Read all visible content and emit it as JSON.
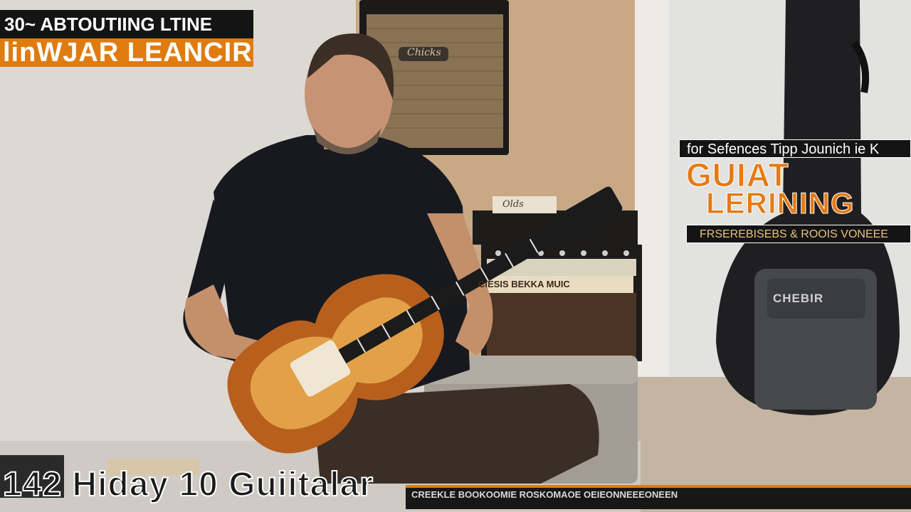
{
  "overlays": {
    "top_left_line1": "30~ ABTOUTIING LTINE",
    "top_left_line2": "linWJAR LEANCIR",
    "right_tagline": "for Sefences Tipp Jounich ie K",
    "right_title_line1": "GUIAT",
    "right_title_line2": "LERINING",
    "right_subtitle": "FRSEREBISEBS & ROOIS VONEEE",
    "bottom_caption": "142  Hiday  10 Guiitalar",
    "bottom_ticker": "CREEKLE BOOKOOMIE  ROSKOMAOE OEIEONNEEEONEEN"
  },
  "scene": {
    "amp_brand_top": "Chicks",
    "amp_label_front": "CIESIS  BEKKA MUIC",
    "amp_badge": "Olds",
    "bag_patch": "CHEBIR"
  },
  "colors": {
    "accent_orange": "#e07b10",
    "bar_black": "#141414",
    "wall": "#d9d6d0",
    "cork": "#c9a882"
  }
}
